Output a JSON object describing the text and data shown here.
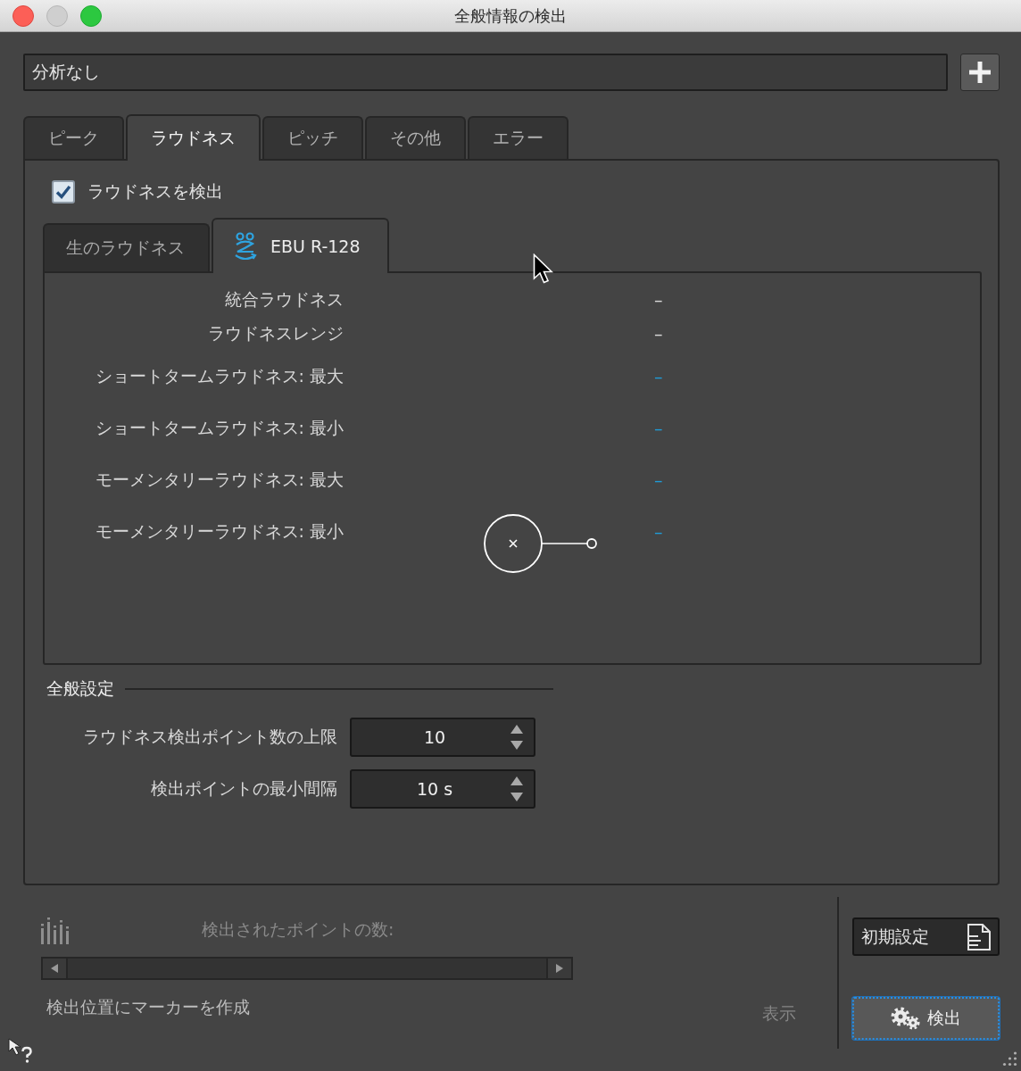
{
  "window": {
    "title": "全般情報の検出"
  },
  "preset": {
    "value": "分析なし"
  },
  "tabs": [
    {
      "label": "ピーク",
      "selected": false
    },
    {
      "label": "ラウドネス",
      "selected": true
    },
    {
      "label": "ピッチ",
      "selected": false
    },
    {
      "label": "その他",
      "selected": false
    },
    {
      "label": "エラー",
      "selected": false
    }
  ],
  "detect_loudness": {
    "label": "ラウドネスを検出",
    "checked": true
  },
  "sub_tabs": [
    {
      "label": "生のラウドネス",
      "selected": false,
      "has_icon": false
    },
    {
      "label": "EBU R-128",
      "selected": true,
      "has_icon": true
    }
  ],
  "measurements": [
    {
      "label": "統合ラウドネス",
      "value": "–",
      "kind": "plain"
    },
    {
      "label": "ラウドネスレンジ",
      "value": "–",
      "kind": "plain"
    },
    {
      "label": "ショートタームラウドネス: 最大",
      "value": "–",
      "kind": "link"
    },
    {
      "label": "ショートタームラウドネス: 最小",
      "value": "–",
      "kind": "link"
    },
    {
      "label": "モーメンタリーラウドネス: 最大",
      "value": "–",
      "kind": "link"
    },
    {
      "label": "モーメンタリーラウドネス: 最小",
      "value": "–",
      "kind": "link"
    }
  ],
  "general_settings": {
    "title": "全般設定",
    "fields": [
      {
        "label": "ラウドネス検出ポイント数の上限",
        "value": "10"
      },
      {
        "label": "検出ポイントの最小間隔",
        "value": "10 s"
      }
    ]
  },
  "results": {
    "count_label": "検出されたポイントの数:",
    "marker_label": "検出位置にマーカーを作成",
    "show_button": {
      "label": "表示",
      "disabled": true
    }
  },
  "buttons": [
    {
      "label": "初期設定",
      "kind": "defaults",
      "focused": false
    },
    {
      "label": "検出",
      "kind": "detect",
      "focused": true
    }
  ]
}
